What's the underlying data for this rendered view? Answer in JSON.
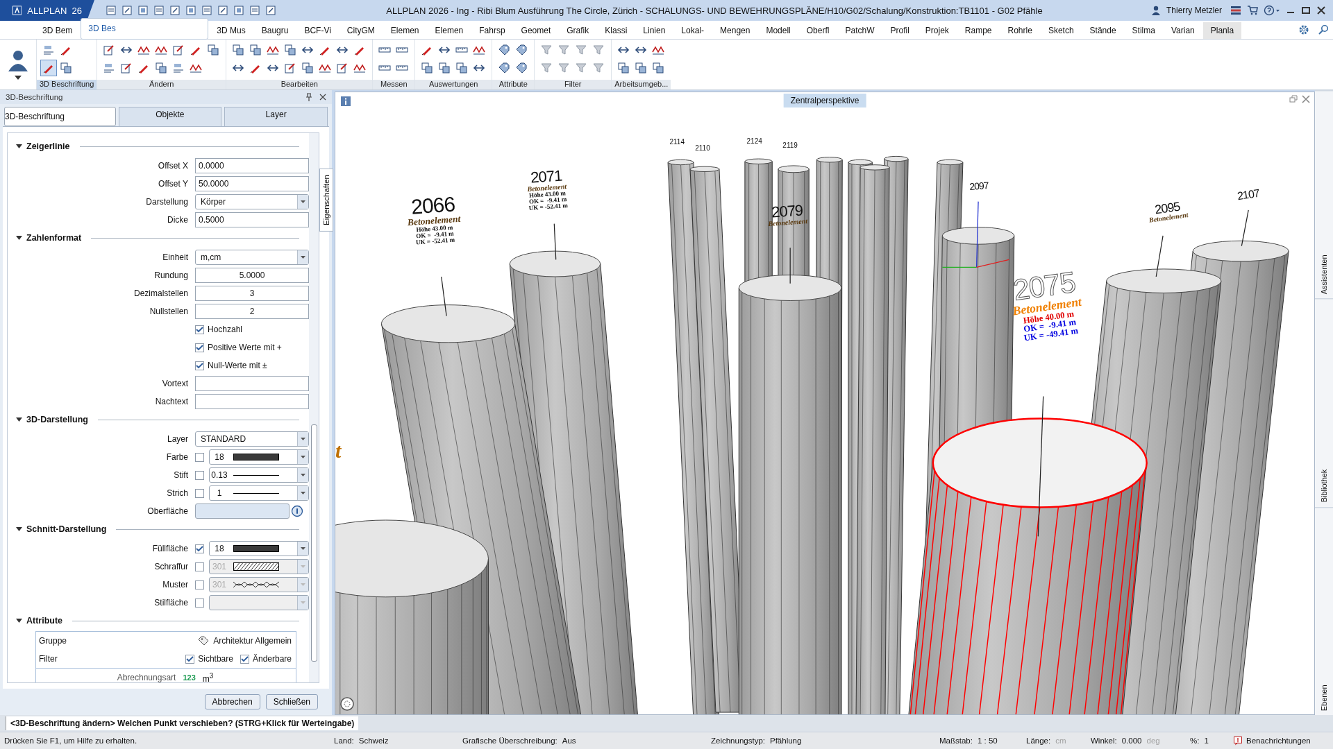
{
  "titlebar": {
    "app_badge": "ALLPLAN  26",
    "title": "ALLPLAN 2026 - Ing - Ribi Blum Ausführung The Circle, Zürich - SCHALUNGS- UND BEWEHRUNGSPLÄNE/H10/G02/Schalung/Konstruktion:TB1101 - G02 Pfähle",
    "user": "Thierry Metzler"
  },
  "ribbon_tabs": [
    {
      "label": "3D Bem",
      "selected": false,
      "hovered": false
    },
    {
      "label": "3D Bes",
      "selected": true,
      "hovered": false
    },
    {
      "label": "3D Mus",
      "selected": false,
      "hovered": false
    },
    {
      "label": "Baugru",
      "selected": false,
      "hovered": false
    },
    {
      "label": "BCF-Vi",
      "selected": false,
      "hovered": false
    },
    {
      "label": "CityGM",
      "selected": false,
      "hovered": false
    },
    {
      "label": "Elemen",
      "selected": false,
      "hovered": false
    },
    {
      "label": "Elemen",
      "selected": false,
      "hovered": false
    },
    {
      "label": "Fahrsp",
      "selected": false,
      "hovered": false
    },
    {
      "label": "Geomet",
      "selected": false,
      "hovered": false
    },
    {
      "label": "Grafik",
      "selected": false,
      "hovered": false
    },
    {
      "label": "Klassi",
      "selected": false,
      "hovered": false
    },
    {
      "label": "Linien",
      "selected": false,
      "hovered": false
    },
    {
      "label": "Lokal-",
      "selected": false,
      "hovered": false
    },
    {
      "label": "Mengen",
      "selected": false,
      "hovered": false
    },
    {
      "label": "Modell",
      "selected": false,
      "hovered": false
    },
    {
      "label": "Oberfl",
      "selected": false,
      "hovered": false
    },
    {
      "label": "PatchW",
      "selected": false,
      "hovered": false
    },
    {
      "label": "Profil",
      "selected": false,
      "hovered": false
    },
    {
      "label": "Projek",
      "selected": false,
      "hovered": false
    },
    {
      "label": "Rampe",
      "selected": false,
      "hovered": false
    },
    {
      "label": "Rohrle",
      "selected": false,
      "hovered": false
    },
    {
      "label": "Sketch",
      "selected": false,
      "hovered": false
    },
    {
      "label": "Stände",
      "selected": false,
      "hovered": false
    },
    {
      "label": "Stilma",
      "selected": false,
      "hovered": false
    },
    {
      "label": "Varian",
      "selected": false,
      "hovered": false
    },
    {
      "label": "Planla",
      "selected": false,
      "hovered": true
    }
  ],
  "ribbon_groups": [
    {
      "label": "3D Beschriftung",
      "selected": true
    },
    {
      "label": "Ändern",
      "selected": false
    },
    {
      "label": "Bearbeiten",
      "selected": false
    },
    {
      "label": "Messen",
      "selected": false
    },
    {
      "label": "Auswertungen",
      "selected": false
    },
    {
      "label": "Attribute",
      "selected": false
    },
    {
      "label": "Filter",
      "selected": false
    },
    {
      "label": "Arbeitsumgeb...",
      "selected": false
    }
  ],
  "panel": {
    "title": "3D-Beschriftung",
    "side_tab": "Eigenschaften",
    "tabs": [
      {
        "label": "3D-Beschriftung",
        "selected": true
      },
      {
        "label": "Objekte",
        "selected": false
      },
      {
        "label": "Layer",
        "selected": false
      }
    ],
    "sections": [
      {
        "title": "Zeigerlinie",
        "expanded": true,
        "rows": [
          {
            "kind": "input",
            "label": "Offset X",
            "value": "0.0000"
          },
          {
            "kind": "input",
            "label": "Offset Y",
            "value": "50.0000"
          },
          {
            "kind": "select",
            "label": "Darstellung",
            "value": "Körper"
          },
          {
            "kind": "input",
            "label": "Dicke",
            "value": "0.5000"
          }
        ]
      },
      {
        "title": "Zahlenformat",
        "expanded": true,
        "rows": [
          {
            "kind": "select",
            "label": "Einheit",
            "value": "m,cm"
          },
          {
            "kind": "number",
            "label": "Rundung",
            "value": "5.0000"
          },
          {
            "kind": "number",
            "label": "Dezimalstellen",
            "value": "3"
          },
          {
            "kind": "number",
            "label": "Nullstellen",
            "value": "2"
          },
          {
            "kind": "check",
            "label": "Hochzahl",
            "checked": true
          },
          {
            "kind": "check",
            "label": "Positive Werte mit +",
            "checked": true
          },
          {
            "kind": "check",
            "label": "Null-Werte mit ±",
            "checked": true
          },
          {
            "kind": "input",
            "label": "Vortext"
          },
          {
            "kind": "input",
            "label": "Nachtext"
          }
        ]
      },
      {
        "title": "3D-Darstellung",
        "expanded": true,
        "rows": [
          {
            "kind": "select",
            "label": "Layer",
            "value": "STANDARD"
          },
          {
            "kind": "fill",
            "label": "Farbe",
            "checked": false,
            "disabled": false,
            "value": "18"
          },
          {
            "kind": "line",
            "label": "Stift",
            "checked": false,
            "disabled": false,
            "value": "0.13"
          },
          {
            "kind": "line",
            "label": "Strich",
            "checked": false,
            "disabled": false,
            "value": "1"
          },
          {
            "kind": "surface",
            "label": "Oberfläche"
          }
        ]
      },
      {
        "title": "Schnitt-Darstellung",
        "expanded": true,
        "rows": [
          {
            "kind": "fill",
            "label": "Füllfläche",
            "checked": true,
            "disabled": false,
            "value": "18"
          },
          {
            "kind": "hatch",
            "label": "Schraffur",
            "checked": false,
            "disabled": true,
            "value": "301"
          },
          {
            "kind": "pattern",
            "label": "Muster",
            "checked": false,
            "disabled": true,
            "value": "301"
          },
          {
            "kind": "style",
            "label": "Stilfläche",
            "checked": false,
            "disabled": true
          }
        ]
      }
    ],
    "attributes": {
      "title": "Attribute",
      "expanded": true,
      "group_label": "Gruppe",
      "group_value": "Architektur Allgemein",
      "filter_label": "Filter",
      "filters": [
        {
          "label": "Sichtbare",
          "checked": true
        },
        {
          "label": "Änderbare",
          "checked": true
        }
      ],
      "billing_label": "Abrechnungsart",
      "billing_code": "123",
      "billing_unit": "m$^{3}$"
    },
    "buttons": [
      "Abbrechen",
      "Schließen"
    ]
  },
  "viewport": {
    "title": "Zentralperspektive",
    "edge_text": "t",
    "labels": [
      {
        "number": "2066",
        "selected": false,
        "lines": [
          "Betonelement",
          "Höhe 43.00 m",
          "OK =  -9.41 m",
          "UK = -52.41 m"
        ]
      },
      {
        "number": "2071",
        "selected": false,
        "lines": [
          "Betonelement",
          "Höhe 43.00 m",
          "OK =  -9.41 m",
          "UK = -52.41 m"
        ]
      },
      {
        "number": "2079",
        "selected": false,
        "lines": [
          "Betonelement"
        ]
      },
      {
        "number": "2097",
        "selected": false
      },
      {
        "number": "2075",
        "selected": true,
        "lines": [
          "Betonelement",
          "Höhe 40.00 m",
          "OK =  -9.41 m",
          "UK = -49.41 m"
        ]
      },
      {
        "number": "2095",
        "selected": false,
        "lines": [
          "Betonelement"
        ]
      },
      {
        "number": "2107",
        "selected": false
      },
      {
        "number": "2114",
        "selected": false
      },
      {
        "number": "2110",
        "selected": false
      },
      {
        "number": "2124",
        "selected": false
      },
      {
        "number": "2119",
        "selected": false
      }
    ],
    "side_tabs": [
      "Assistenten",
      "Bibliothek",
      "Ebenen"
    ]
  },
  "command_line": "<3D-Beschriftung ändern> Welchen Punkt verschieben? (STRG+Klick für Werteingabe)",
  "status_bar": {
    "help": "Drücken Sie F1, um Hilfe zu erhalten.",
    "items": [
      {
        "label": "Land:",
        "value": "Schweiz"
      },
      {
        "label": "Grafische Überschreibung:",
        "value": "Aus"
      },
      {
        "label": "Zeichnungstyp:",
        "value": "Pfählung"
      },
      {
        "label": "Maßstab:",
        "value": "1 : 50"
      },
      {
        "label": "Länge:",
        "unit": "cm"
      },
      {
        "label": "Winkel:",
        "value": "0.000",
        "unit": "deg"
      },
      {
        "label": "%:",
        "value": "1"
      }
    ],
    "notifications": "Benachrichtungen"
  }
}
